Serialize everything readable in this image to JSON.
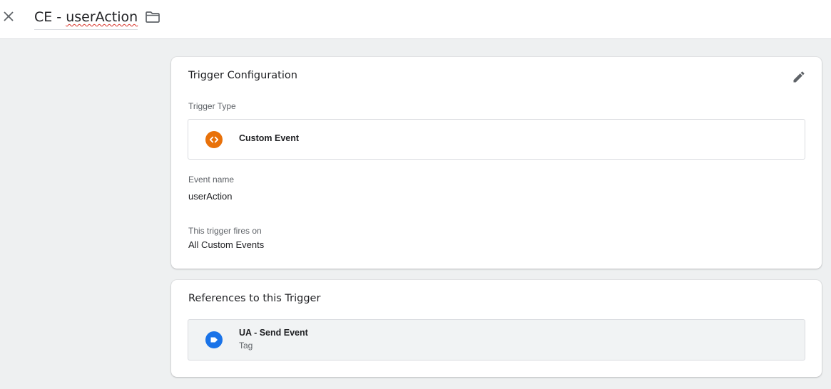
{
  "header": {
    "title_prefix": "CE - ",
    "title_name": "userAction",
    "close_icon": "close-icon",
    "folder_icon": "folder-icon"
  },
  "trigger_config": {
    "title": "Trigger Configuration",
    "edit_icon": "pencil-icon",
    "type_label": "Trigger Type",
    "type_name": "Custom Event",
    "type_icon": "custom-event-icon",
    "type_icon_color": "#e8710a",
    "event_name_label": "Event name",
    "event_name_value": "userAction",
    "fires_on_label": "This trigger fires on",
    "fires_on_value": "All Custom Events"
  },
  "references": {
    "title": "References to this Trigger",
    "items": [
      {
        "name": "UA - Send Event",
        "type": "Tag",
        "icon": "tag-icon",
        "icon_color": "#1a73e8"
      }
    ]
  }
}
